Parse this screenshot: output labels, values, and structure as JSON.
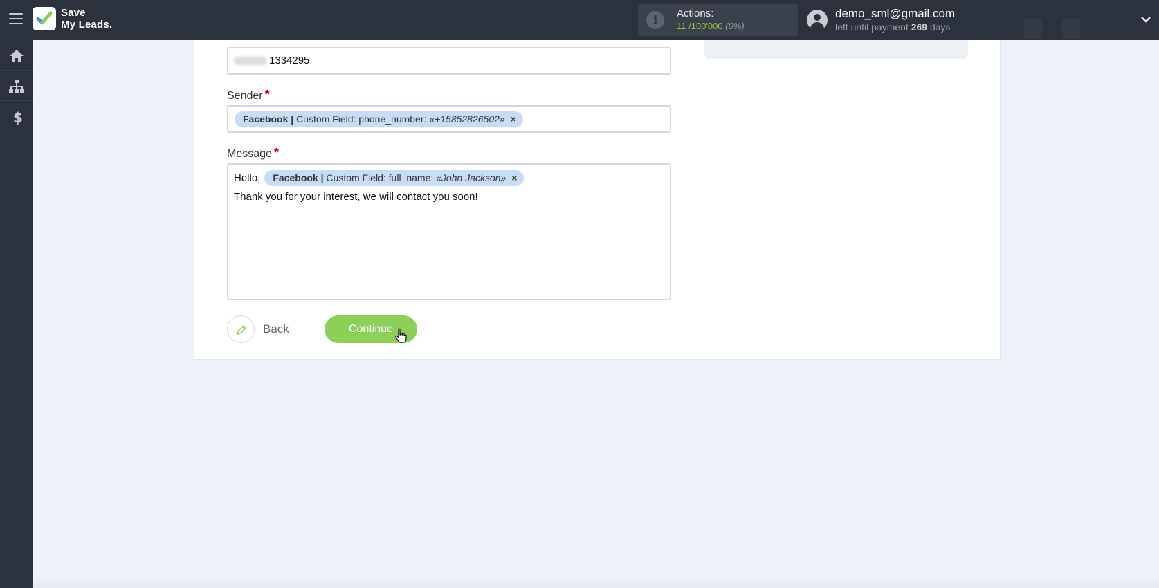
{
  "app": {
    "logo_text_line1": "Save",
    "logo_text_line2": "My Leads."
  },
  "header": {
    "actions_label": "Actions:",
    "actions_used": "11",
    "actions_total": "/100'000",
    "actions_percent": "(0%)",
    "user_email": "demo_sml@gmail.com",
    "payment_prefix": "left until payment",
    "payment_days": "269",
    "payment_suffix": "days"
  },
  "sidebar": {
    "items": [
      {
        "name": "home",
        "icon": "home-icon"
      },
      {
        "name": "connections",
        "icon": "sitemap-icon"
      },
      {
        "name": "billing",
        "icon": "dollar-icon"
      }
    ]
  },
  "form": {
    "recipient_value": "1334295",
    "sender_label": "Sender",
    "sender_tag": {
      "source": "Facebook",
      "separator": "|",
      "field": "Custom Field: phone_number:",
      "value": "«+15852826502»",
      "remove": "×"
    },
    "message_label": "Message",
    "message_prefix": "Hello,",
    "message_tag": {
      "source": "Facebook",
      "separator": "|",
      "field": "Custom Field: full_name:",
      "value": "«John Jackson»",
      "remove": "×"
    },
    "message_line2": "Thank you for your interest, we will contact you soon!",
    "required_mark": "*"
  },
  "buttons": {
    "back_label": "Back",
    "continue_label": "Continue"
  },
  "colors": {
    "topbar": "#2c323d",
    "accent_green": "#8cd05a",
    "tag_bg": "#c8ddf5",
    "required": "#d0021b"
  }
}
